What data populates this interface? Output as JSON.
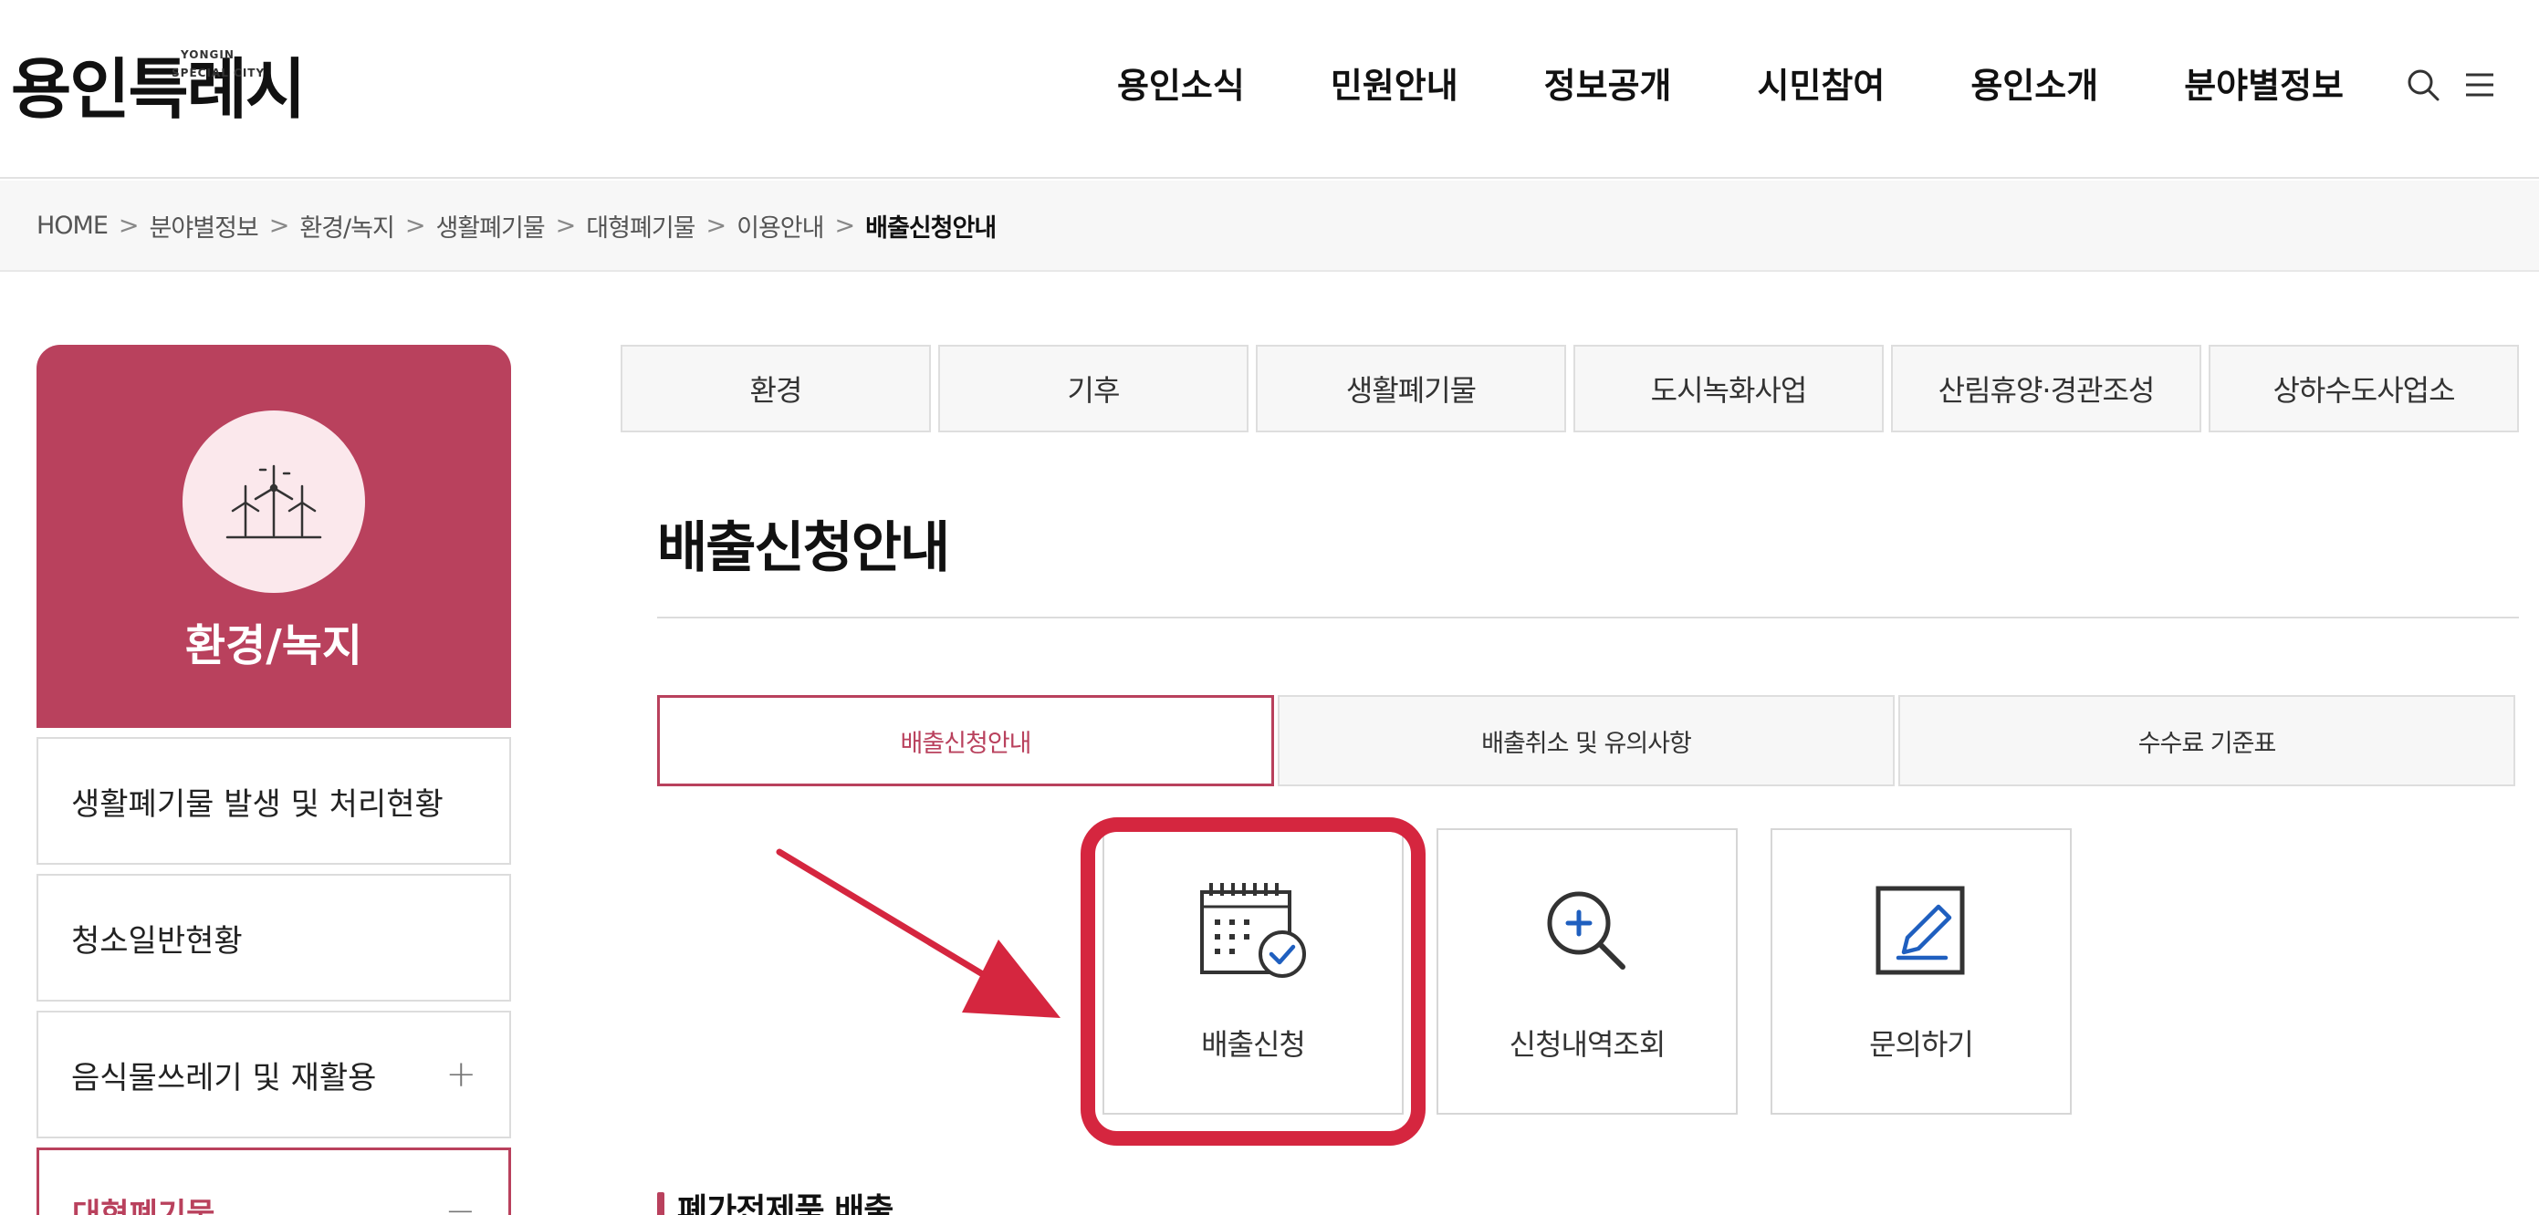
{
  "header": {
    "logo_text": "용인특례시",
    "logo_sub_1": "YONGIN",
    "logo_sub_2": "SPECIAL CITY",
    "nav": [
      "용인소식",
      "민원안내",
      "정보공개",
      "시민참여",
      "용인소개",
      "분야별정보"
    ]
  },
  "breadcrumb": {
    "items": [
      "HOME",
      "분야별정보",
      "환경/녹지",
      "생활폐기물",
      "대형폐기물",
      "이용안내"
    ],
    "separator": ">",
    "current": "배출신청안내"
  },
  "sidebar": {
    "title": "환경/녹지",
    "icon": "wind-turbine-icon",
    "items": [
      {
        "label": "생활폐기물 발생 및 처리현황",
        "toggle": ""
      },
      {
        "label": "청소일반현황",
        "toggle": ""
      },
      {
        "label": "음식물쓰레기 및 재활용",
        "toggle": "+"
      },
      {
        "label": "대형폐기물",
        "toggle": "−"
      }
    ]
  },
  "categories": [
    "환경",
    "기후",
    "생활폐기물",
    "도시녹화사업",
    "산림휴양·경관조성",
    "상하수도사업소"
  ],
  "page_title": "배출신청안내",
  "subtabs": [
    {
      "label": "배출신청안내",
      "active": true
    },
    {
      "label": "배출취소 및 유의사항",
      "active": false
    },
    {
      "label": "수수료 기준표",
      "active": false
    }
  ],
  "actions": [
    {
      "label": "배출신청",
      "icon": "calendar-check-icon"
    },
    {
      "label": "신청내역조회",
      "icon": "search-plus-icon"
    },
    {
      "label": "문의하기",
      "icon": "edit-pencil-icon"
    }
  ],
  "section_heading": "폐가전제품 배출",
  "colors": {
    "brand": "#b9415d",
    "highlight": "#d5263f",
    "icon_blue": "#1f5fbf"
  }
}
